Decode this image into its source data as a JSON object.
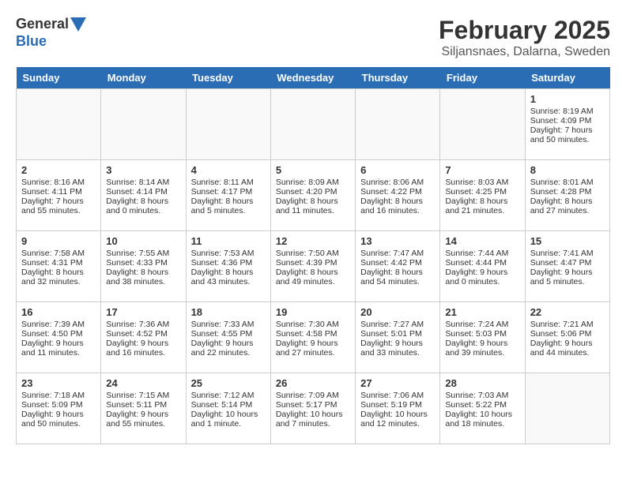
{
  "header": {
    "logo_line1": "General",
    "logo_line2": "Blue",
    "title": "February 2025",
    "subtitle": "Siljansnaes, Dalarna, Sweden"
  },
  "days_of_week": [
    "Sunday",
    "Monday",
    "Tuesday",
    "Wednesday",
    "Thursday",
    "Friday",
    "Saturday"
  ],
  "weeks": [
    [
      {
        "num": "",
        "empty": true
      },
      {
        "num": "",
        "empty": true
      },
      {
        "num": "",
        "empty": true
      },
      {
        "num": "",
        "empty": true
      },
      {
        "num": "",
        "empty": true
      },
      {
        "num": "",
        "empty": true
      },
      {
        "num": "1",
        "lines": [
          "Sunrise: 8:19 AM",
          "Sunset: 4:09 PM",
          "Daylight: 7 hours",
          "and 50 minutes."
        ]
      }
    ],
    [
      {
        "num": "2",
        "lines": [
          "Sunrise: 8:16 AM",
          "Sunset: 4:11 PM",
          "Daylight: 7 hours",
          "and 55 minutes."
        ]
      },
      {
        "num": "3",
        "lines": [
          "Sunrise: 8:14 AM",
          "Sunset: 4:14 PM",
          "Daylight: 8 hours",
          "and 0 minutes."
        ]
      },
      {
        "num": "4",
        "lines": [
          "Sunrise: 8:11 AM",
          "Sunset: 4:17 PM",
          "Daylight: 8 hours",
          "and 5 minutes."
        ]
      },
      {
        "num": "5",
        "lines": [
          "Sunrise: 8:09 AM",
          "Sunset: 4:20 PM",
          "Daylight: 8 hours",
          "and 11 minutes."
        ]
      },
      {
        "num": "6",
        "lines": [
          "Sunrise: 8:06 AM",
          "Sunset: 4:22 PM",
          "Daylight: 8 hours",
          "and 16 minutes."
        ]
      },
      {
        "num": "7",
        "lines": [
          "Sunrise: 8:03 AM",
          "Sunset: 4:25 PM",
          "Daylight: 8 hours",
          "and 21 minutes."
        ]
      },
      {
        "num": "8",
        "lines": [
          "Sunrise: 8:01 AM",
          "Sunset: 4:28 PM",
          "Daylight: 8 hours",
          "and 27 minutes."
        ]
      }
    ],
    [
      {
        "num": "9",
        "lines": [
          "Sunrise: 7:58 AM",
          "Sunset: 4:31 PM",
          "Daylight: 8 hours",
          "and 32 minutes."
        ]
      },
      {
        "num": "10",
        "lines": [
          "Sunrise: 7:55 AM",
          "Sunset: 4:33 PM",
          "Daylight: 8 hours",
          "and 38 minutes."
        ]
      },
      {
        "num": "11",
        "lines": [
          "Sunrise: 7:53 AM",
          "Sunset: 4:36 PM",
          "Daylight: 8 hours",
          "and 43 minutes."
        ]
      },
      {
        "num": "12",
        "lines": [
          "Sunrise: 7:50 AM",
          "Sunset: 4:39 PM",
          "Daylight: 8 hours",
          "and 49 minutes."
        ]
      },
      {
        "num": "13",
        "lines": [
          "Sunrise: 7:47 AM",
          "Sunset: 4:42 PM",
          "Daylight: 8 hours",
          "and 54 minutes."
        ]
      },
      {
        "num": "14",
        "lines": [
          "Sunrise: 7:44 AM",
          "Sunset: 4:44 PM",
          "Daylight: 9 hours",
          "and 0 minutes."
        ]
      },
      {
        "num": "15",
        "lines": [
          "Sunrise: 7:41 AM",
          "Sunset: 4:47 PM",
          "Daylight: 9 hours",
          "and 5 minutes."
        ]
      }
    ],
    [
      {
        "num": "16",
        "lines": [
          "Sunrise: 7:39 AM",
          "Sunset: 4:50 PM",
          "Daylight: 9 hours",
          "and 11 minutes."
        ]
      },
      {
        "num": "17",
        "lines": [
          "Sunrise: 7:36 AM",
          "Sunset: 4:52 PM",
          "Daylight: 9 hours",
          "and 16 minutes."
        ]
      },
      {
        "num": "18",
        "lines": [
          "Sunrise: 7:33 AM",
          "Sunset: 4:55 PM",
          "Daylight: 9 hours",
          "and 22 minutes."
        ]
      },
      {
        "num": "19",
        "lines": [
          "Sunrise: 7:30 AM",
          "Sunset: 4:58 PM",
          "Daylight: 9 hours",
          "and 27 minutes."
        ]
      },
      {
        "num": "20",
        "lines": [
          "Sunrise: 7:27 AM",
          "Sunset: 5:01 PM",
          "Daylight: 9 hours",
          "and 33 minutes."
        ]
      },
      {
        "num": "21",
        "lines": [
          "Sunrise: 7:24 AM",
          "Sunset: 5:03 PM",
          "Daylight: 9 hours",
          "and 39 minutes."
        ]
      },
      {
        "num": "22",
        "lines": [
          "Sunrise: 7:21 AM",
          "Sunset: 5:06 PM",
          "Daylight: 9 hours",
          "and 44 minutes."
        ]
      }
    ],
    [
      {
        "num": "23",
        "lines": [
          "Sunrise: 7:18 AM",
          "Sunset: 5:09 PM",
          "Daylight: 9 hours",
          "and 50 minutes."
        ]
      },
      {
        "num": "24",
        "lines": [
          "Sunrise: 7:15 AM",
          "Sunset: 5:11 PM",
          "Daylight: 9 hours",
          "and 55 minutes."
        ]
      },
      {
        "num": "25",
        "lines": [
          "Sunrise: 7:12 AM",
          "Sunset: 5:14 PM",
          "Daylight: 10 hours",
          "and 1 minute."
        ]
      },
      {
        "num": "26",
        "lines": [
          "Sunrise: 7:09 AM",
          "Sunset: 5:17 PM",
          "Daylight: 10 hours",
          "and 7 minutes."
        ]
      },
      {
        "num": "27",
        "lines": [
          "Sunrise: 7:06 AM",
          "Sunset: 5:19 PM",
          "Daylight: 10 hours",
          "and 12 minutes."
        ]
      },
      {
        "num": "28",
        "lines": [
          "Sunrise: 7:03 AM",
          "Sunset: 5:22 PM",
          "Daylight: 10 hours",
          "and 18 minutes."
        ]
      },
      {
        "num": "",
        "empty": true
      }
    ]
  ]
}
